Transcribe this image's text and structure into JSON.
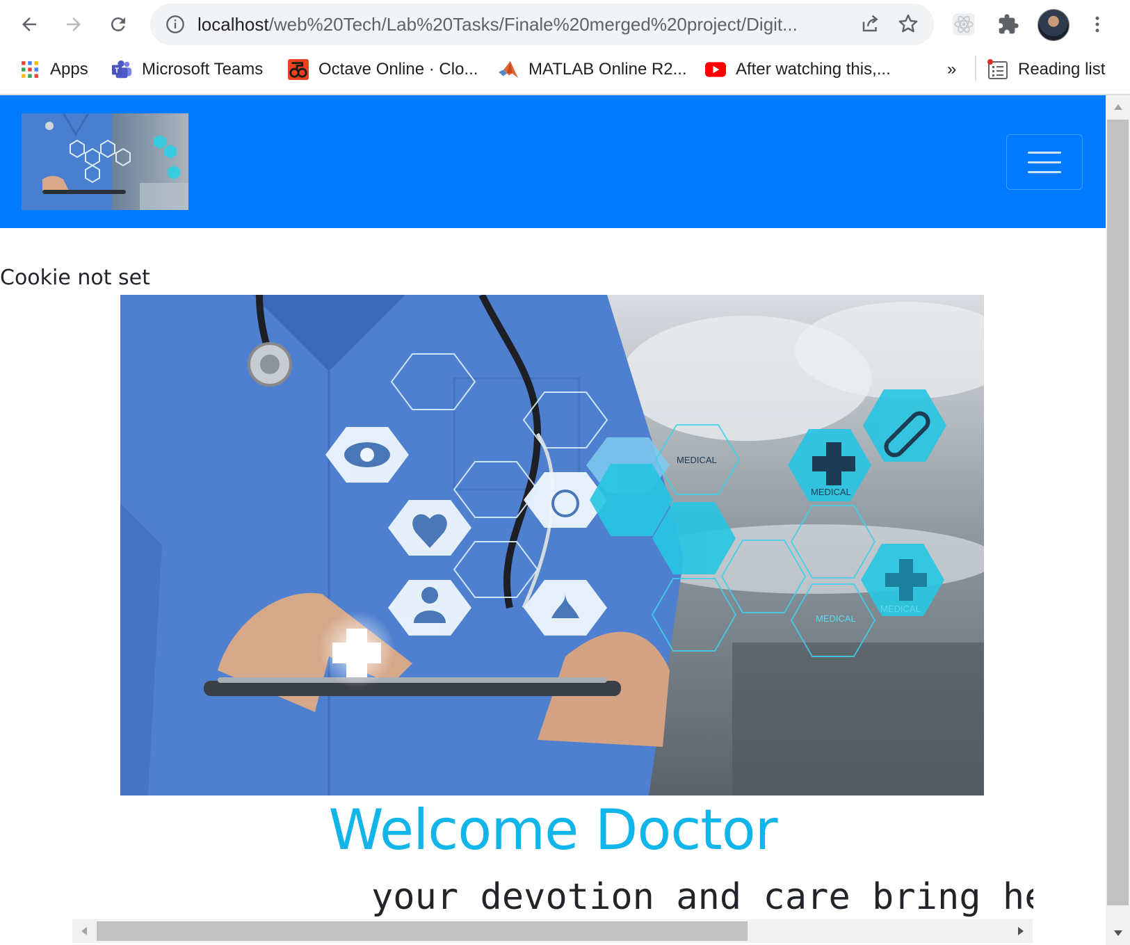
{
  "browser": {
    "url_host": "localhost",
    "url_path": "/web%20Tech/Lab%20Tasks/Finale%20merged%20project/Digit...",
    "bookmarks": [
      {
        "label": "Apps",
        "icon": "apps-grid-icon"
      },
      {
        "label": "Microsoft Teams",
        "icon": "microsoft-teams-icon"
      },
      {
        "label": "Octave Online · Clo...",
        "icon": "octave-online-icon"
      },
      {
        "label": "MATLAB Online R2...",
        "icon": "matlab-icon"
      },
      {
        "label": "After watching this,...",
        "icon": "youtube-icon"
      }
    ],
    "overflow_label": "»",
    "reading_list_label": "Reading list"
  },
  "page": {
    "cookie_status": "Cookie not set",
    "welcome_heading": "Welcome Doctor",
    "tagline": "your devotion and care bring he",
    "hero_labels": {
      "medical_1": "MEDICAL",
      "medical_2": "MEDICAL",
      "medical_3": "MEDICAL",
      "medical_4": "MEDICAL"
    }
  },
  "colors": {
    "navbar": "#007bff",
    "welcome": "#12b5ea",
    "scrub": "#4a7fd0"
  }
}
